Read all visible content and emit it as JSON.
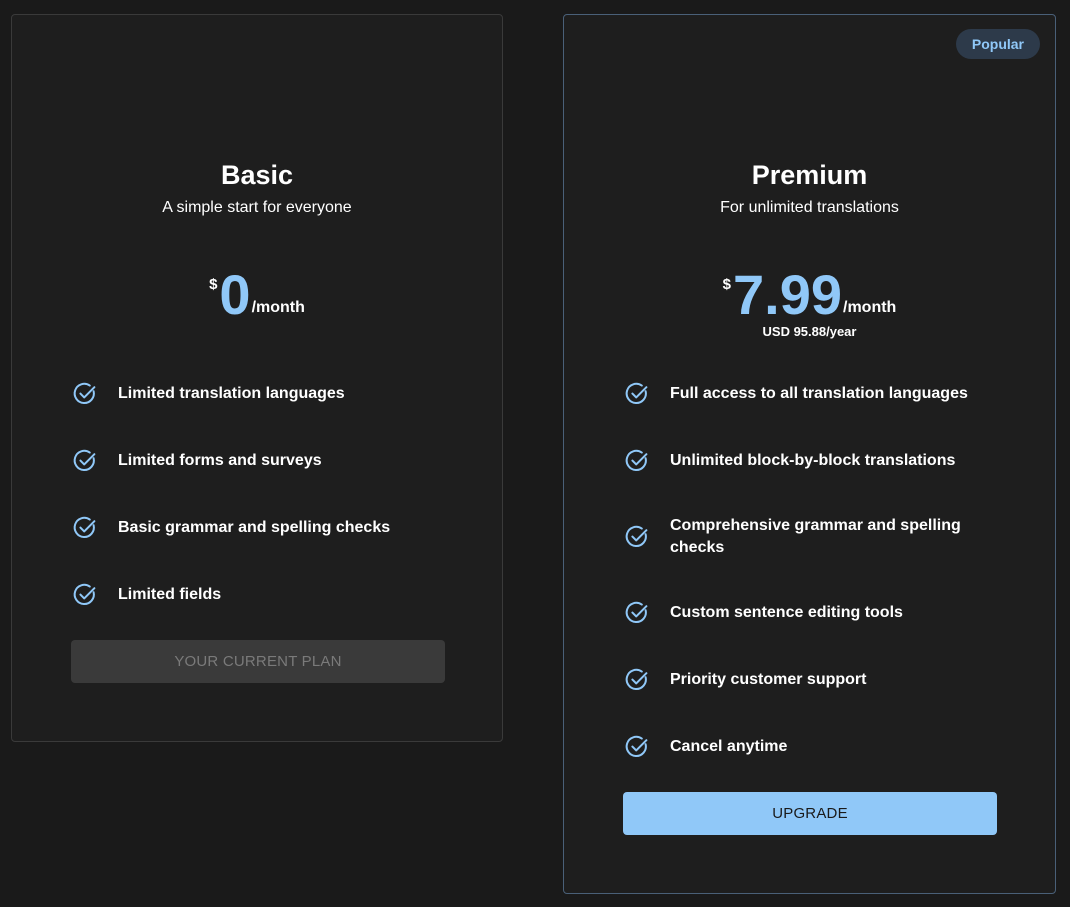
{
  "plans": {
    "basic": {
      "title": "Basic",
      "subtitle": "A simple start for everyone",
      "currency": "$",
      "amount": "0",
      "period": "/month",
      "features": [
        "Limited translation languages",
        "Limited forms and surveys",
        "Basic grammar and spelling checks",
        "Limited fields"
      ],
      "button_label": "YOUR CURRENT PLAN"
    },
    "premium": {
      "badge": "Popular",
      "title": "Premium",
      "subtitle": "For unlimited translations",
      "currency": "$",
      "amount": "7.99",
      "period": "/month",
      "yearly": "USD 95.88/year",
      "features": [
        "Full access to all translation languages",
        "Unlimited block-by-block translations",
        "Comprehensive grammar and spelling checks",
        "Custom sentence editing tools",
        "Priority customer support",
        "Cancel anytime"
      ],
      "button_label": "UPGRADE"
    }
  },
  "icons": {
    "feature": "check-circle-icon"
  },
  "colors": {
    "accent": "#90c8f8",
    "card_background": "#1e1e1e",
    "page_background": "#1a1a1a",
    "badge_background": "#2d3a4a",
    "disabled_button": "#3a3a3a"
  }
}
